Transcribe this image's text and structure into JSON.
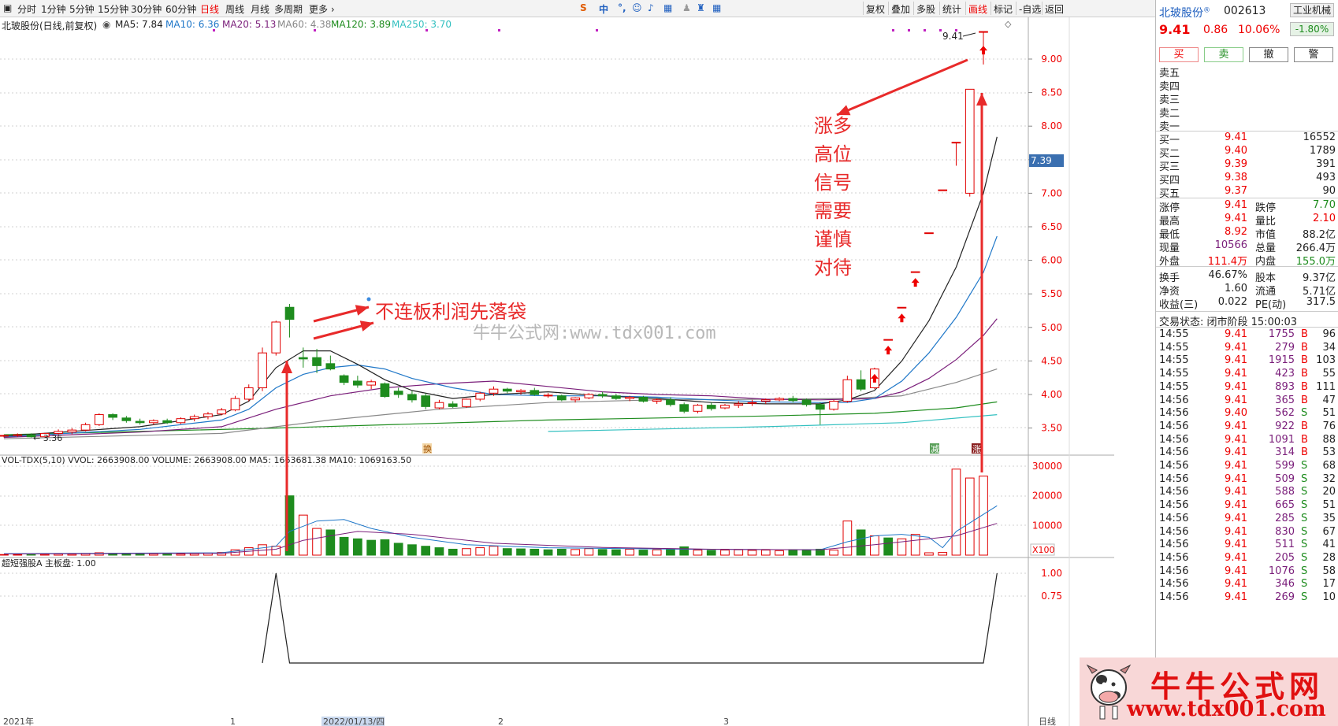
{
  "toolbar": {
    "periods": [
      "分时",
      "1分钟",
      "5分钟",
      "15分钟",
      "30分钟",
      "60分钟",
      "日线",
      "周线",
      "月线",
      "多周期",
      "更多 ›"
    ],
    "right": [
      "复权",
      "叠加",
      "多股",
      "统计",
      "画线",
      "标记",
      "-自选",
      "返回"
    ]
  },
  "ma_line": {
    "title": "北玻股份(日线,前复权)",
    "ma5": "MA5: 7.84",
    "ma10": "MA10: 6.36",
    "ma20": "MA20: 5.13",
    "ma60": "MA60: 4.38",
    "ma120": "MA120: 3.89",
    "ma250": "MA250: 3.70"
  },
  "colors": {
    "up": "#e00000",
    "down": "#1e8c1e",
    "ma5": "#222222",
    "ma10": "#1f77c8",
    "ma20": "#7a1e7a",
    "ma60": "#888888",
    "ma120": "#1e8c1e",
    "ma250": "#33c0c0"
  },
  "chart_data": {
    "type": "candlestick",
    "price_axis": {
      "ticks": [
        "9.00",
        "8.50",
        "8.00",
        "7.50",
        "7.00",
        "6.50",
        "6.00",
        "5.50",
        "5.00",
        "4.50",
        "4.00",
        "3.50"
      ],
      "current": "7.39",
      "high_label": "9.41",
      "low_label": "← 3.36"
    },
    "vol_axis": {
      "ticks": [
        "30000",
        "20000",
        "10000"
      ],
      "unit": "X100"
    },
    "ind_axis": {
      "ticks": [
        "1.00",
        "0.75"
      ]
    },
    "x_labels": [
      "2021年",
      "1",
      "2022/01/13/四",
      "2",
      "3",
      "日线"
    ],
    "markers": [
      "换",
      "减",
      "涨"
    ],
    "candles": [
      [
        3.38,
        3.4,
        3.36,
        3.39
      ],
      [
        3.39,
        3.42,
        3.37,
        3.4
      ],
      [
        3.4,
        3.42,
        3.36,
        3.37
      ],
      [
        3.37,
        3.43,
        3.36,
        3.42
      ],
      [
        3.42,
        3.48,
        3.4,
        3.45
      ],
      [
        3.44,
        3.5,
        3.41,
        3.47
      ],
      [
        3.47,
        3.58,
        3.45,
        3.55
      ],
      [
        3.55,
        3.72,
        3.53,
        3.7
      ],
      [
        3.7,
        3.72,
        3.62,
        3.66
      ],
      [
        3.65,
        3.68,
        3.58,
        3.61
      ],
      [
        3.6,
        3.64,
        3.55,
        3.58
      ],
      [
        3.58,
        3.63,
        3.55,
        3.61
      ],
      [
        3.61,
        3.64,
        3.56,
        3.58
      ],
      [
        3.58,
        3.66,
        3.56,
        3.64
      ],
      [
        3.64,
        3.7,
        3.6,
        3.67
      ],
      [
        3.67,
        3.74,
        3.63,
        3.71
      ],
      [
        3.71,
        3.8,
        3.69,
        3.77
      ],
      [
        3.77,
        3.98,
        3.75,
        3.94
      ],
      [
        3.93,
        4.15,
        3.9,
        4.1
      ],
      [
        4.1,
        4.7,
        4.05,
        4.62
      ],
      [
        4.62,
        5.1,
        4.58,
        5.08
      ],
      [
        5.3,
        5.35,
        4.85,
        5.12
      ],
      [
        4.55,
        4.7,
        4.4,
        4.53
      ],
      [
        4.55,
        4.68,
        4.32,
        4.43
      ],
      [
        4.46,
        4.58,
        4.36,
        4.38
      ],
      [
        4.28,
        4.3,
        4.14,
        4.18
      ],
      [
        4.2,
        4.28,
        4.1,
        4.14
      ],
      [
        4.14,
        4.22,
        4.08,
        4.19
      ],
      [
        4.16,
        4.18,
        3.95,
        3.97
      ],
      [
        4.05,
        4.1,
        3.95,
        4.0
      ],
      [
        4.0,
        4.05,
        3.88,
        3.92
      ],
      [
        3.98,
        4.02,
        3.78,
        3.82
      ],
      [
        3.8,
        3.92,
        3.78,
        3.88
      ],
      [
        3.86,
        3.9,
        3.8,
        3.82
      ],
      [
        3.82,
        3.94,
        3.8,
        3.93
      ],
      [
        3.93,
        4.04,
        3.9,
        4.02
      ],
      [
        4.02,
        4.12,
        3.98,
        4.08
      ],
      [
        4.08,
        4.1,
        4.02,
        4.05
      ],
      [
        4.04,
        4.08,
        4.0,
        4.06
      ],
      [
        4.06,
        4.1,
        3.98,
        4.0
      ],
      [
        3.99,
        4.02,
        3.95,
        3.99
      ],
      [
        3.98,
        4.0,
        3.9,
        3.92
      ],
      [
        3.92,
        3.96,
        3.88,
        3.95
      ],
      [
        3.95,
        4.02,
        3.93,
        4.0
      ],
      [
        4.0,
        4.04,
        3.95,
        3.98
      ],
      [
        3.98,
        4.01,
        3.92,
        3.94
      ],
      [
        3.94,
        3.98,
        3.9,
        3.96
      ],
      [
        3.96,
        3.98,
        3.88,
        3.9
      ],
      [
        3.9,
        3.94,
        3.86,
        3.92
      ],
      [
        3.92,
        3.96,
        3.82,
        3.85
      ],
      [
        3.85,
        3.88,
        3.72,
        3.75
      ],
      [
        3.75,
        3.86,
        3.72,
        3.84
      ],
      [
        3.84,
        3.88,
        3.76,
        3.79
      ],
      [
        3.8,
        3.86,
        3.78,
        3.84
      ],
      [
        3.84,
        3.9,
        3.8,
        3.86
      ],
      [
        3.87,
        3.92,
        3.83,
        3.88
      ],
      [
        3.9,
        3.94,
        3.86,
        3.92
      ],
      [
        3.92,
        3.96,
        3.9,
        3.94
      ],
      [
        3.94,
        3.98,
        3.88,
        3.91
      ],
      [
        3.92,
        3.94,
        3.82,
        3.85
      ],
      [
        3.85,
        3.88,
        3.55,
        3.78
      ],
      [
        3.78,
        3.92,
        3.76,
        3.9
      ],
      [
        3.9,
        4.28,
        3.88,
        4.22
      ],
      [
        4.22,
        4.36,
        4.05,
        4.08
      ],
      [
        4.1,
        4.4,
        4.08,
        4.38
      ],
      [
        4.82,
        4.82,
        4.82,
        4.82
      ],
      [
        5.3,
        5.3,
        5.3,
        5.3
      ],
      [
        5.83,
        5.83,
        5.83,
        5.83
      ],
      [
        6.41,
        6.41,
        6.41,
        6.41
      ],
      [
        7.05,
        7.05,
        7.05,
        7.05
      ],
      [
        7.76,
        7.76,
        7.41,
        7.76
      ],
      [
        7.0,
        8.55,
        6.95,
        8.55
      ],
      [
        9.4,
        9.41,
        8.92,
        9.41
      ]
    ],
    "ma5": [
      [
        0,
        3.38
      ],
      [
        10,
        3.52
      ],
      [
        16,
        3.7
      ],
      [
        18,
        3.9
      ],
      [
        20,
        4.4
      ],
      [
        22,
        4.65
      ],
      [
        24,
        4.65
      ],
      [
        26,
        4.45
      ],
      [
        28,
        4.22
      ],
      [
        30,
        4.06
      ],
      [
        33,
        3.94
      ],
      [
        36,
        4.0
      ],
      [
        40,
        4.04
      ],
      [
        44,
        3.98
      ],
      [
        48,
        3.94
      ],
      [
        52,
        3.88
      ],
      [
        56,
        3.86
      ],
      [
        60,
        3.86
      ],
      [
        62,
        3.92
      ],
      [
        64,
        4.06
      ],
      [
        66,
        4.5
      ],
      [
        68,
        5.1
      ],
      [
        70,
        5.9
      ],
      [
        72,
        7.0
      ],
      [
        73,
        7.84
      ]
    ],
    "ma10": [
      [
        0,
        3.37
      ],
      [
        10,
        3.48
      ],
      [
        16,
        3.62
      ],
      [
        18,
        3.78
      ],
      [
        20,
        4.1
      ],
      [
        22,
        4.3
      ],
      [
        24,
        4.4
      ],
      [
        26,
        4.44
      ],
      [
        28,
        4.38
      ],
      [
        30,
        4.24
      ],
      [
        33,
        4.1
      ],
      [
        36,
        4.0
      ],
      [
        40,
        3.98
      ],
      [
        44,
        3.98
      ],
      [
        48,
        3.96
      ],
      [
        52,
        3.92
      ],
      [
        56,
        3.89
      ],
      [
        60,
        3.88
      ],
      [
        62,
        3.88
      ],
      [
        64,
        3.94
      ],
      [
        66,
        4.2
      ],
      [
        68,
        4.62
      ],
      [
        70,
        5.15
      ],
      [
        72,
        5.82
      ],
      [
        73,
        6.36
      ]
    ],
    "ma20": [
      [
        0,
        3.36
      ],
      [
        10,
        3.44
      ],
      [
        16,
        3.52
      ],
      [
        20,
        3.78
      ],
      [
        24,
        3.98
      ],
      [
        28,
        4.1
      ],
      [
        32,
        4.16
      ],
      [
        36,
        4.2
      ],
      [
        40,
        4.12
      ],
      [
        44,
        4.04
      ],
      [
        48,
        4.0
      ],
      [
        52,
        3.98
      ],
      [
        56,
        3.93
      ],
      [
        60,
        3.92
      ],
      [
        64,
        3.94
      ],
      [
        66,
        4.04
      ],
      [
        68,
        4.24
      ],
      [
        70,
        4.52
      ],
      [
        72,
        4.88
      ],
      [
        73,
        5.13
      ]
    ],
    "ma60": [
      [
        0,
        3.34
      ],
      [
        16,
        3.42
      ],
      [
        24,
        3.62
      ],
      [
        32,
        3.78
      ],
      [
        40,
        3.88
      ],
      [
        48,
        3.92
      ],
      [
        56,
        3.93
      ],
      [
        62,
        3.94
      ],
      [
        66,
        3.98
      ],
      [
        70,
        4.18
      ],
      [
        73,
        4.38
      ]
    ],
    "ma120": [
      [
        0,
        3.4
      ],
      [
        20,
        3.5
      ],
      [
        40,
        3.62
      ],
      [
        56,
        3.68
      ],
      [
        64,
        3.72
      ],
      [
        70,
        3.8
      ],
      [
        73,
        3.89
      ]
    ],
    "ma250": [
      [
        40,
        3.45
      ],
      [
        56,
        3.52
      ],
      [
        66,
        3.58
      ],
      [
        73,
        3.7
      ]
    ],
    "volume": [
      [
        200,
        1
      ],
      [
        180,
        1
      ],
      [
        150,
        0
      ],
      [
        300,
        1
      ],
      [
        400,
        1
      ],
      [
        350,
        1
      ],
      [
        600,
        1
      ],
      [
        800,
        1
      ],
      [
        500,
        0
      ],
      [
        400,
        0
      ],
      [
        300,
        0
      ],
      [
        450,
        1
      ],
      [
        350,
        0
      ],
      [
        400,
        1
      ],
      [
        500,
        1
      ],
      [
        700,
        1
      ],
      [
        900,
        1
      ],
      [
        1800,
        1
      ],
      [
        2500,
        1
      ],
      [
        3500,
        1
      ],
      [
        3000,
        1
      ],
      [
        20000,
        0
      ],
      [
        13500,
        1
      ],
      [
        9000,
        1
      ],
      [
        8500,
        0
      ],
      [
        6000,
        0
      ],
      [
        5500,
        0
      ],
      [
        5000,
        0
      ],
      [
        5200,
        0
      ],
      [
        4000,
        0
      ],
      [
        3500,
        0
      ],
      [
        3000,
        0
      ],
      [
        2500,
        0
      ],
      [
        2000,
        0
      ],
      [
        2200,
        1
      ],
      [
        2500,
        1
      ],
      [
        3000,
        1
      ],
      [
        2200,
        0
      ],
      [
        2100,
        0
      ],
      [
        2000,
        0
      ],
      [
        1800,
        0
      ],
      [
        2000,
        0
      ],
      [
        1900,
        1
      ],
      [
        2200,
        1
      ],
      [
        1900,
        0
      ],
      [
        1800,
        0
      ],
      [
        2000,
        1
      ],
      [
        1700,
        0
      ],
      [
        1800,
        1
      ],
      [
        1900,
        0
      ],
      [
        2800,
        0
      ],
      [
        1700,
        1
      ],
      [
        1600,
        0
      ],
      [
        1700,
        1
      ],
      [
        1800,
        1
      ],
      [
        1600,
        1
      ],
      [
        1700,
        1
      ],
      [
        1500,
        1
      ],
      [
        1700,
        0
      ],
      [
        1800,
        0
      ],
      [
        2000,
        0
      ],
      [
        1700,
        1
      ],
      [
        11500,
        1
      ],
      [
        8500,
        0
      ],
      [
        6500,
        1
      ],
      [
        5800,
        0
      ],
      [
        5500,
        1
      ],
      [
        7000,
        1
      ],
      [
        800,
        1
      ],
      [
        900,
        1
      ],
      [
        29000,
        1
      ],
      [
        26000,
        1
      ],
      [
        26639,
        1
      ]
    ],
    "vol_ma5": [
      [
        0,
        500
      ],
      [
        16,
        800
      ],
      [
        20,
        3000
      ],
      [
        21,
        8000
      ],
      [
        23,
        11500
      ],
      [
        25,
        12000
      ],
      [
        27,
        9000
      ],
      [
        30,
        6000
      ],
      [
        34,
        3500
      ],
      [
        40,
        2500
      ],
      [
        50,
        2000
      ],
      [
        60,
        1800
      ],
      [
        62,
        4500
      ],
      [
        64,
        6500
      ],
      [
        66,
        7000
      ],
      [
        68,
        6000
      ],
      [
        69,
        2500
      ],
      [
        70,
        8000
      ],
      [
        73,
        16637
      ]
    ],
    "vol_ma10": [
      [
        0,
        400
      ],
      [
        16,
        600
      ],
      [
        20,
        2000
      ],
      [
        22,
        5000
      ],
      [
        26,
        8000
      ],
      [
        30,
        7000
      ],
      [
        36,
        4000
      ],
      [
        44,
        2600
      ],
      [
        52,
        2000
      ],
      [
        60,
        1800
      ],
      [
        64,
        3500
      ],
      [
        68,
        5500
      ],
      [
        70,
        6500
      ],
      [
        73,
        10692
      ]
    ],
    "indicator": [
      [
        19,
        0
      ],
      [
        20,
        1
      ],
      [
        21,
        0
      ],
      [
        71,
        0
      ],
      [
        72,
        0
      ],
      [
        73,
        1
      ]
    ],
    "annotations": {
      "left": "不连板利润先落袋",
      "right": [
        "涨多",
        "高位",
        "信号",
        "需要",
        "谨慎",
        "对待"
      ],
      "watermark": "牛牛公式网:www.tdx001.com"
    },
    "vol_line": "VOL-TDX(5,10) VVOL: 2663908.00 VOLUME: 2663908.00 MA5: 1663681.38 MA10: 1069163.50",
    "ind_line": "超短强股A 主板盘: 1.00"
  },
  "quote": {
    "name": "北玻股份",
    "reg": "®",
    "code": "002613",
    "industry": "工业机械",
    "industry_pct": "-1.80%",
    "price": "9.41",
    "change": "0.86",
    "pct": "10.06%",
    "buttons": [
      "买",
      "卖",
      "撤",
      "警"
    ],
    "sell": [
      "卖五",
      "卖四",
      "卖三",
      "卖二",
      "卖一"
    ],
    "buy": [
      [
        "买一",
        "9.41",
        "16552"
      ],
      [
        "买二",
        "9.40",
        "1789"
      ],
      [
        "买三",
        "9.39",
        "391"
      ],
      [
        "买四",
        "9.38",
        "493"
      ],
      [
        "买五",
        "9.37",
        "90"
      ]
    ],
    "stats": [
      [
        "涨停",
        "9.41",
        "跌停",
        "7.70"
      ],
      [
        "最高",
        "9.41",
        "量比",
        "2.10"
      ],
      [
        "最低",
        "8.92",
        "市值",
        "88.2亿"
      ],
      [
        "现量",
        "10566",
        "总量",
        "266.4万"
      ],
      [
        "外盘",
        "111.4万",
        "内盘",
        "155.0万"
      ]
    ],
    "stats2": [
      [
        "换手",
        "46.67%",
        "股本",
        "9.37亿"
      ],
      [
        "净资",
        "1.60",
        "流通",
        "5.71亿"
      ],
      [
        "收益(三)",
        "0.022",
        "PE(动)",
        "317.5"
      ]
    ],
    "trade_status": "交易状态: 闭市阶段 15:00:03",
    "ticks": [
      [
        "14:55",
        "9.41",
        "1755",
        "B",
        "96"
      ],
      [
        "14:55",
        "9.41",
        "279",
        "B",
        "34"
      ],
      [
        "14:55",
        "9.41",
        "1915",
        "B",
        "103"
      ],
      [
        "14:55",
        "9.41",
        "423",
        "B",
        "55"
      ],
      [
        "14:55",
        "9.41",
        "893",
        "B",
        "111"
      ],
      [
        "14:56",
        "9.41",
        "365",
        "B",
        "47"
      ],
      [
        "14:56",
        "9.40",
        "562",
        "S",
        "51"
      ],
      [
        "14:56",
        "9.41",
        "922",
        "B",
        "76"
      ],
      [
        "14:56",
        "9.41",
        "1091",
        "B",
        "88"
      ],
      [
        "14:56",
        "9.41",
        "314",
        "B",
        "53"
      ],
      [
        "14:56",
        "9.41",
        "599",
        "S",
        "68"
      ],
      [
        "14:56",
        "9.41",
        "509",
        "S",
        "32"
      ],
      [
        "14:56",
        "9.41",
        "588",
        "S",
        "20"
      ],
      [
        "14:56",
        "9.41",
        "665",
        "S",
        "51"
      ],
      [
        "14:56",
        "9.41",
        "285",
        "S",
        "35"
      ],
      [
        "14:56",
        "9.41",
        "830",
        "S",
        "67"
      ],
      [
        "14:56",
        "9.41",
        "511",
        "S",
        "41"
      ],
      [
        "14:56",
        "9.41",
        "205",
        "S",
        "28"
      ],
      [
        "14:56",
        "9.41",
        "1076",
        "S",
        "58"
      ],
      [
        "14:56",
        "9.41",
        "346",
        "S",
        "17"
      ],
      [
        "14:56",
        "9.41",
        "269",
        "S",
        "10"
      ]
    ]
  },
  "watermark": {
    "t1": "牛牛公式网",
    "t2": "www.tdx001.com"
  }
}
